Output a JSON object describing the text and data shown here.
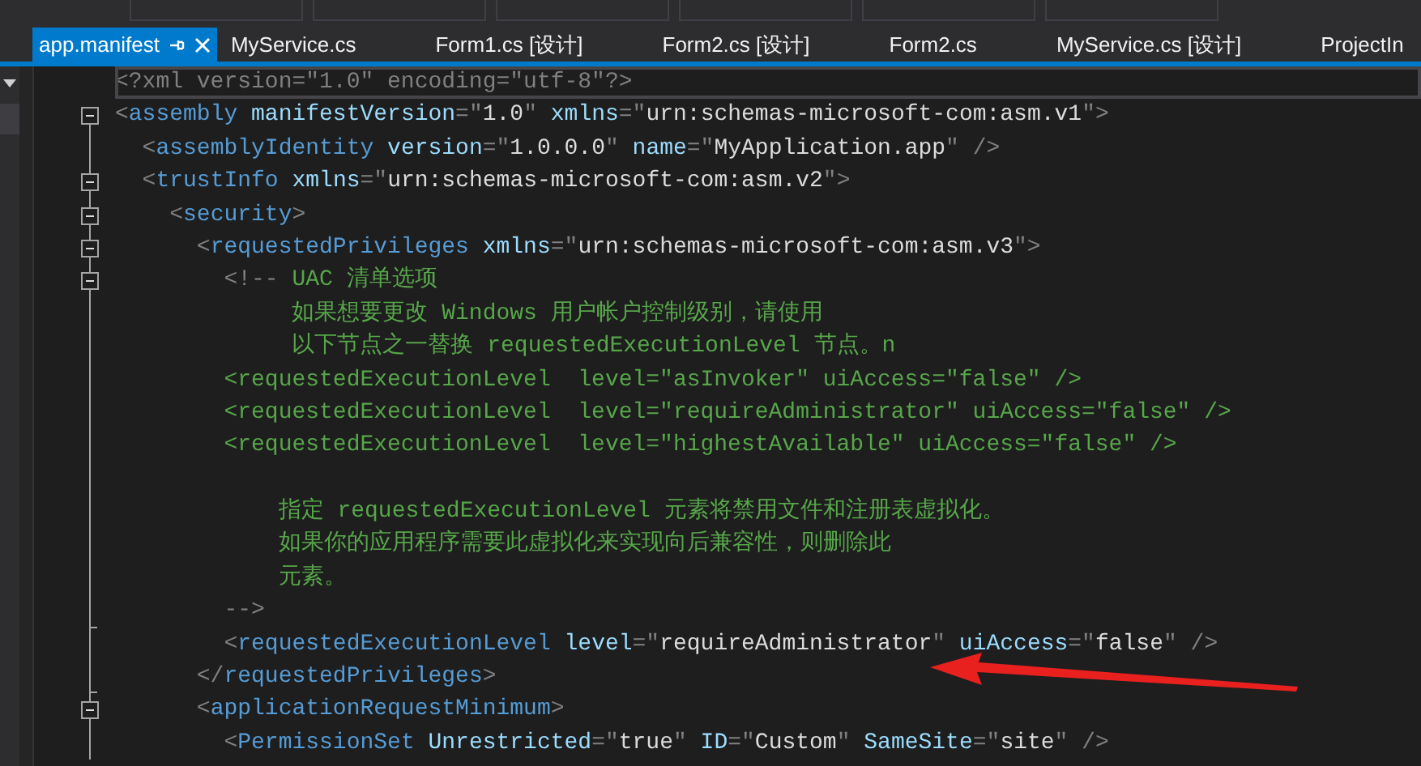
{
  "tabs": [
    {
      "label": "app.manifest",
      "selected": true
    },
    {
      "label": "MyService.cs",
      "selected": false
    },
    {
      "label": "Form1.cs [设计]",
      "selected": false
    },
    {
      "label": "Form2.cs [设计]",
      "selected": false
    },
    {
      "label": "Form2.cs",
      "selected": false
    },
    {
      "label": "MyService.cs [设计]",
      "selected": false
    },
    {
      "label": "ProjectIn",
      "selected": false
    }
  ],
  "editor": {
    "lines": [
      {
        "current": true,
        "tokens": [
          {
            "kind": "punct",
            "text": "<?xml version=\"1.0\" encoding=\"utf-8\"?>"
          }
        ]
      },
      {
        "current": false,
        "kind": "minus",
        "tokens": [
          {
            "kind": "punct",
            "text": "<"
          },
          {
            "kind": "tag",
            "text": "assembly"
          },
          {
            "kind": "attr",
            "text": " manifestVersion"
          },
          {
            "kind": "punct",
            "text": "=\""
          },
          {
            "kind": "value",
            "text": "1.0"
          },
          {
            "kind": "punct",
            "text": "\""
          },
          {
            "kind": "attr",
            "text": " xmlns"
          },
          {
            "kind": "punct",
            "text": "=\""
          },
          {
            "kind": "value",
            "text": "urn:schemas-microsoft-com:asm.v1"
          },
          {
            "kind": "punct",
            "text": "\">"
          }
        ]
      },
      {
        "current": false,
        "kind": "bar",
        "tokens": [
          {
            "kind": "punct",
            "text": "  <"
          },
          {
            "kind": "tag",
            "text": "assemblyIdentity"
          },
          {
            "kind": "attr",
            "text": " version"
          },
          {
            "kind": "punct",
            "text": "=\""
          },
          {
            "kind": "value",
            "text": "1.0.0.0"
          },
          {
            "kind": "punct",
            "text": "\""
          },
          {
            "kind": "attr",
            "text": " name"
          },
          {
            "kind": "punct",
            "text": "=\""
          },
          {
            "kind": "value",
            "text": "MyApplication.app"
          },
          {
            "kind": "punct",
            "text": "\" />"
          }
        ]
      },
      {
        "current": false,
        "kind": "minus",
        "tokens": [
          {
            "kind": "punct",
            "text": "  <"
          },
          {
            "kind": "tag",
            "text": "trustInfo"
          },
          {
            "kind": "attr",
            "text": " xmlns"
          },
          {
            "kind": "punct",
            "text": "=\""
          },
          {
            "kind": "value",
            "text": "urn:schemas-microsoft-com:asm.v2"
          },
          {
            "kind": "punct",
            "text": "\">"
          }
        ]
      },
      {
        "current": false,
        "kind": "minus",
        "tokens": [
          {
            "kind": "punct",
            "text": "    <"
          },
          {
            "kind": "tag",
            "text": "security"
          },
          {
            "kind": "punct",
            "text": ">"
          }
        ]
      },
      {
        "current": false,
        "kind": "minus",
        "tokens": [
          {
            "kind": "punct",
            "text": "      <"
          },
          {
            "kind": "tag",
            "text": "requestedPrivileges"
          },
          {
            "kind": "attr",
            "text": " xmlns"
          },
          {
            "kind": "punct",
            "text": "=\""
          },
          {
            "kind": "value",
            "text": "urn:schemas-microsoft-com:asm.v3"
          },
          {
            "kind": "punct",
            "text": "\">"
          }
        ]
      },
      {
        "current": false,
        "kind": "minus",
        "tokens": [
          {
            "kind": "punct",
            "text": "        <!--"
          },
          {
            "kind": "comment",
            "text": " UAC 清单选项"
          }
        ]
      },
      {
        "current": false,
        "kind": "bar",
        "tokens": [
          {
            "kind": "comment",
            "text": "             如果想要更改 Windows 用户帐户控制级别，请使用"
          }
        ]
      },
      {
        "current": false,
        "kind": "bar",
        "tokens": [
          {
            "kind": "comment",
            "text": "             以下节点之一替换 requestedExecutionLevel 节点。n"
          }
        ]
      },
      {
        "current": false,
        "kind": "bar",
        "tokens": [
          {
            "kind": "comment",
            "text": "        <requestedExecutionLevel  level=\"asInvoker\" uiAccess=\"false\" />"
          }
        ]
      },
      {
        "current": false,
        "kind": "bar",
        "tokens": [
          {
            "kind": "comment",
            "text": "        <requestedExecutionLevel  level=\"requireAdministrator\" uiAccess=\"false\" />"
          }
        ]
      },
      {
        "current": false,
        "kind": "bar",
        "tokens": [
          {
            "kind": "comment",
            "text": "        <requestedExecutionLevel  level=\"highestAvailable\" uiAccess=\"false\" />"
          }
        ]
      },
      {
        "current": false,
        "kind": "bar"
      },
      {
        "current": false,
        "kind": "bar",
        "tokens": [
          {
            "kind": "comment",
            "text": "            指定 requestedExecutionLevel 元素将禁用文件和注册表虚拟化。"
          }
        ]
      },
      {
        "current": false,
        "kind": "bar",
        "tokens": [
          {
            "kind": "comment",
            "text": "            如果你的应用程序需要此虚拟化来实现向后兼容性，则删除此"
          }
        ]
      },
      {
        "current": false,
        "kind": "bar",
        "tokens": [
          {
            "kind": "comment",
            "text": "            元素。"
          }
        ]
      },
      {
        "current": false,
        "kind": "end",
        "tokens": [
          {
            "kind": "punct",
            "text": "        -->"
          }
        ]
      },
      {
        "current": false,
        "kind": "bar",
        "tokens": [
          {
            "kind": "punct",
            "text": "        <"
          },
          {
            "kind": "tag",
            "text": "requestedExecutionLevel"
          },
          {
            "kind": "attr",
            "text": " level"
          },
          {
            "kind": "punct",
            "text": "=\""
          },
          {
            "kind": "value",
            "text": "requireAdministrator"
          },
          {
            "kind": "punct",
            "text": "\""
          },
          {
            "kind": "attr",
            "text": " uiAccess"
          },
          {
            "kind": "punct",
            "text": "=\""
          },
          {
            "kind": "value",
            "text": "false"
          },
          {
            "kind": "punct",
            "text": "\" />"
          }
        ]
      },
      {
        "current": false,
        "kind": "end",
        "tokens": [
          {
            "kind": "punct",
            "text": "      </"
          },
          {
            "kind": "tag",
            "text": "requestedPrivileges"
          },
          {
            "kind": "punct",
            "text": ">"
          }
        ]
      },
      {
        "current": false,
        "kind": "minus",
        "tokens": [
          {
            "kind": "punct",
            "text": "      <"
          },
          {
            "kind": "tag",
            "text": "applicationRequestMinimum"
          },
          {
            "kind": "punct",
            "text": ">"
          }
        ]
      },
      {
        "current": false,
        "kind": "bar",
        "tokens": [
          {
            "kind": "punct",
            "text": "        <"
          },
          {
            "kind": "tag",
            "text": "PermissionSet"
          },
          {
            "kind": "attr",
            "text": " Unrestricted"
          },
          {
            "kind": "punct",
            "text": "=\""
          },
          {
            "kind": "value",
            "text": "true"
          },
          {
            "kind": "punct",
            "text": "\""
          },
          {
            "kind": "attr",
            "text": " ID"
          },
          {
            "kind": "punct",
            "text": "=\""
          },
          {
            "kind": "value",
            "text": "Custom"
          },
          {
            "kind": "punct",
            "text": "\""
          },
          {
            "kind": "attr",
            "text": " SameSite"
          },
          {
            "kind": "punct",
            "text": "=\""
          },
          {
            "kind": "value",
            "text": "site"
          },
          {
            "kind": "punct",
            "text": "\" />"
          }
        ]
      }
    ]
  }
}
